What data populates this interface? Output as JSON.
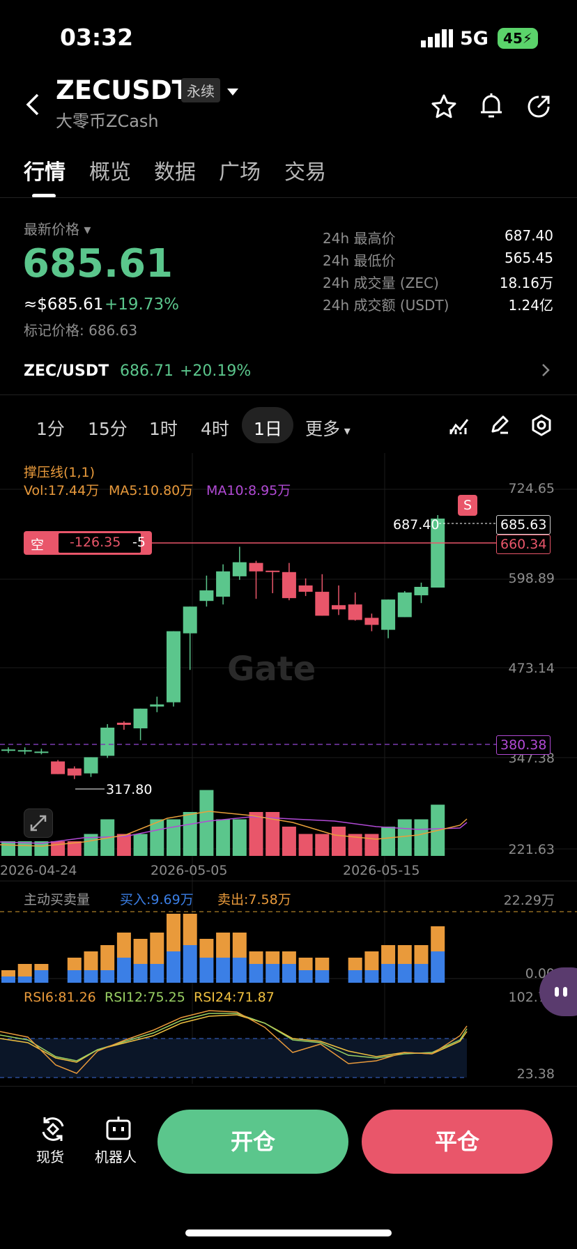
{
  "status_bar": {
    "time": "03:32",
    "network": "5G",
    "battery": "45"
  },
  "header": {
    "symbol": "ZECUSDT",
    "contract_badge": "永续",
    "subtitle": "大零币ZCash"
  },
  "tabs": [
    "行情",
    "概览",
    "数据",
    "广场",
    "交易"
  ],
  "price": {
    "label": "最新价格",
    "last": "685.61",
    "usd": "≈$685.61",
    "change": "+19.73%",
    "mark": "标记价格: 686.63"
  },
  "stats": [
    {
      "label": "24h 最高价",
      "value": "687.40"
    },
    {
      "label": "24h 最低价",
      "value": "565.45"
    },
    {
      "label": "24h 成交量 (ZEC)",
      "value": "18.16万"
    },
    {
      "label": "24h 成交额 (USDT)",
      "value": "1.24亿"
    }
  ],
  "spot": {
    "pair": "ZEC/USDT",
    "price": "686.71",
    "change": "+20.19%"
  },
  "timeframes": [
    "1分",
    "15分",
    "1时",
    "4时",
    "1日",
    "更多"
  ],
  "chart": {
    "indicator_label": "撑压线(1,1)",
    "vol": "Vol:17.44万",
    "ma5": "MA5:10.80万",
    "ma10": "MA10:8.95万",
    "y_ticks": [
      "724.65",
      "598.89",
      "473.14",
      "347.38",
      "221.63"
    ],
    "high_label": "687.40",
    "low_label": "317.80",
    "last_price_tag": "685.63",
    "resistance_tag": "660.34",
    "support_tag": "380.38",
    "position": {
      "side": "空",
      "pnl": "-126.35",
      "qty": "-5"
    },
    "sell_marker": "S",
    "dates": [
      "2026-04-24",
      "2026-05-05",
      "2026-05-15"
    ],
    "watermark": "Gate"
  },
  "active_volume": {
    "title": "主动买卖量",
    "buy": "买入:9.69万",
    "sell": "卖出:7.58万",
    "y_top": "22.29万",
    "y_bottom": "0.00"
  },
  "rsi": {
    "rsi6": "RSI6:81.26",
    "rsi12": "RSI12:75.25",
    "rsi24": "RSI24:71.87",
    "y_top": "102.75",
    "y_bottom": "23.38"
  },
  "bottom_bar": {
    "spot_label": "现货",
    "robot_label": "机器人",
    "open_label": "开仓",
    "close_label": "平仓"
  },
  "colors": {
    "up": "#5bc68c",
    "down": "#e9566a",
    "buy": "#3b7fe6",
    "sell": "#e99a3b",
    "ma10": "#b24ad6",
    "ma5": "#e9a03b"
  }
}
